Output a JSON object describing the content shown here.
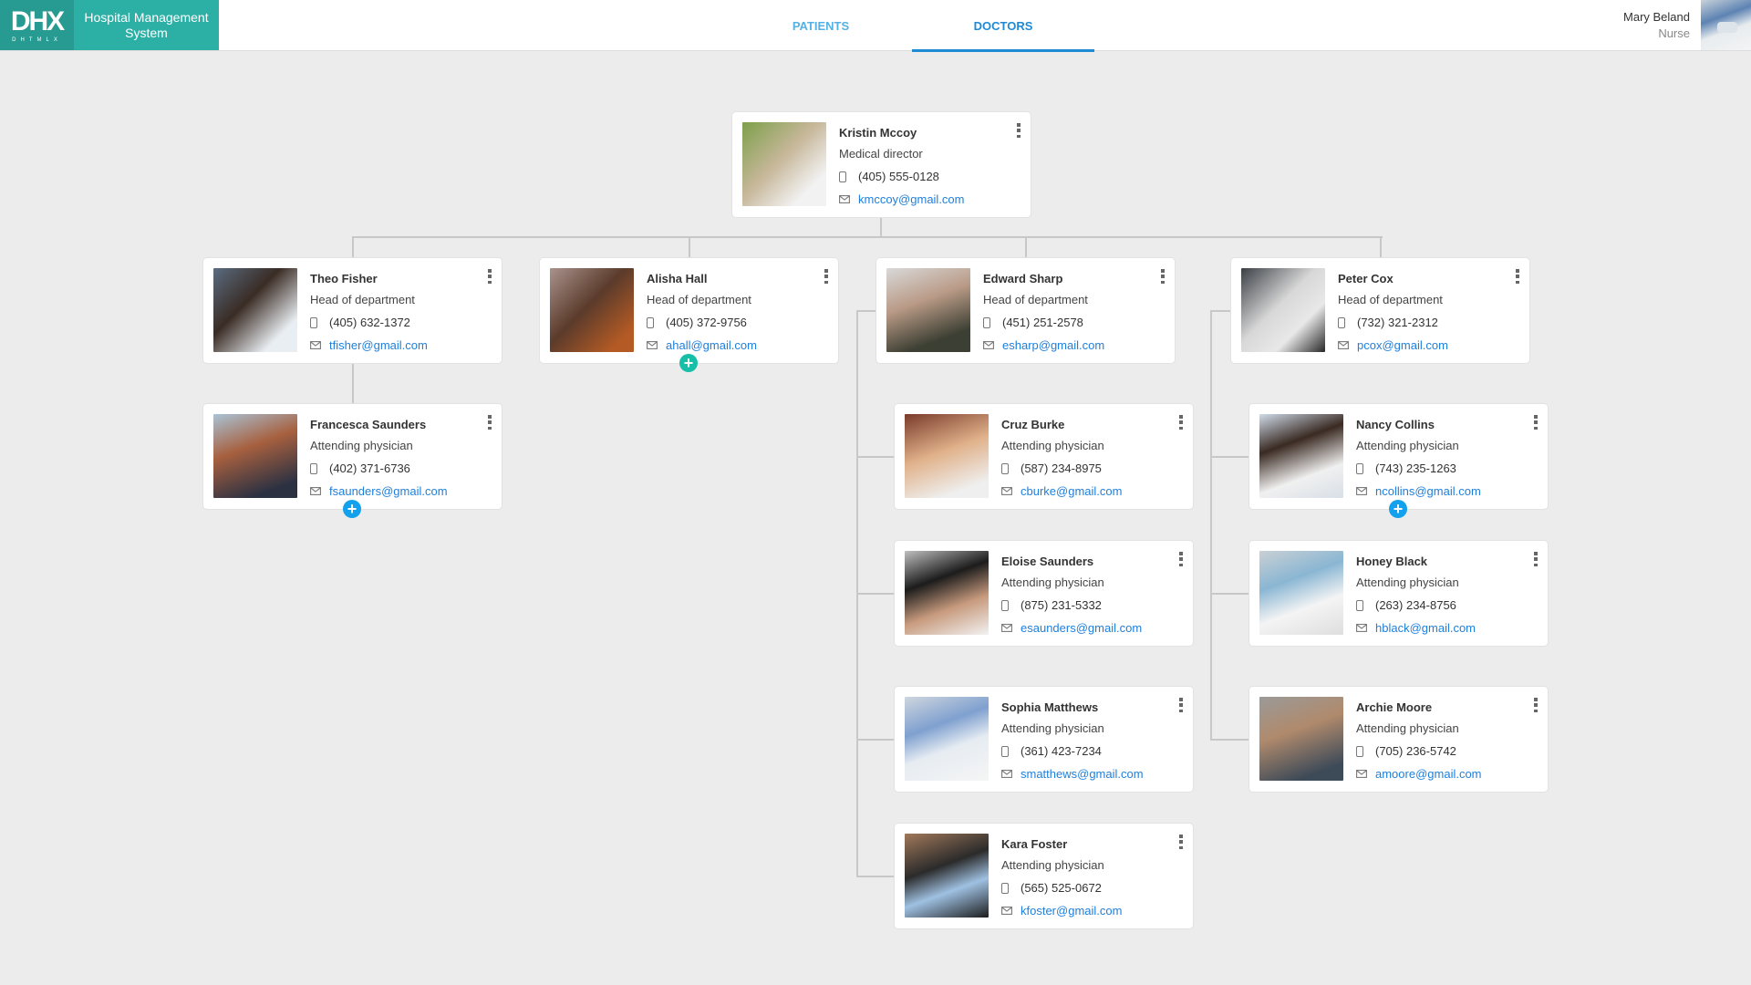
{
  "app": {
    "logo_text": "DHX",
    "logo_subtext": "DHTMLX",
    "title": "Hospital Management System"
  },
  "tabs": [
    {
      "label": "PATIENTS",
      "active": false
    },
    {
      "label": "DOCTORS",
      "active": true
    }
  ],
  "user": {
    "name": "Mary Beland",
    "role": "Nurse"
  },
  "colors": {
    "brand": "#2cb0a6",
    "accent": "#1f8ad4",
    "link": "#1f7fdb",
    "add_blue": "#13a0ec",
    "add_teal": "#17bfa8"
  },
  "doctors": [
    {
      "id": "kmccoy",
      "name": "Kristin Mccoy",
      "title": "Medical director",
      "phone": "(405) 555-0128",
      "email": "kmccoy@gmail.com",
      "parent": null
    },
    {
      "id": "tfisher",
      "name": "Theo Fisher",
      "title": "Head of department",
      "phone": "(405) 632-1372",
      "email": "tfisher@gmail.com",
      "parent": "kmccoy"
    },
    {
      "id": "ahall",
      "name": "Alisha Hall",
      "title": "Head of department",
      "phone": "(405) 372-9756",
      "email": "ahall@gmail.com",
      "parent": "kmccoy"
    },
    {
      "id": "esharp",
      "name": "Edward Sharp",
      "title": "Head of department",
      "phone": "(451) 251-2578",
      "email": "esharp@gmail.com",
      "parent": "kmccoy"
    },
    {
      "id": "pcox",
      "name": "Peter Cox",
      "title": "Head of department",
      "phone": "(732) 321-2312",
      "email": "pcox@gmail.com",
      "parent": "kmccoy"
    },
    {
      "id": "fsaunders",
      "name": "Francesca Saunders",
      "title": "Attending physician",
      "phone": "(402) 371-6736",
      "email": "fsaunders@gmail.com",
      "parent": "tfisher"
    },
    {
      "id": "cburke",
      "name": "Cruz Burke",
      "title": "Attending physician",
      "phone": "(587) 234-8975",
      "email": "cburke@gmail.com",
      "parent": "esharp"
    },
    {
      "id": "esaunders",
      "name": "Eloise Saunders",
      "title": "Attending physician",
      "phone": "(875) 231-5332",
      "email": "esaunders@gmail.com",
      "parent": "esharp"
    },
    {
      "id": "smatthews",
      "name": "Sophia Matthews",
      "title": "Attending physician",
      "phone": "(361) 423-7234",
      "email": "smatthews@gmail.com",
      "parent": "esharp"
    },
    {
      "id": "kfoster",
      "name": "Kara Foster",
      "title": "Attending physician",
      "phone": "(565) 525-0672",
      "email": "kfoster@gmail.com",
      "parent": "esharp"
    },
    {
      "id": "ncollins",
      "name": "Nancy Collins",
      "title": "Attending physician",
      "phone": "(743) 235-1263",
      "email": "ncollins@gmail.com",
      "parent": "pcox"
    },
    {
      "id": "hblack",
      "name": "Honey Black",
      "title": "Attending physician",
      "phone": "(263) 234-8756",
      "email": "hblack@gmail.com",
      "parent": "pcox"
    },
    {
      "id": "amoore",
      "name": "Archie Moore",
      "title": "Attending physician",
      "phone": "(705) 236-5742",
      "email": "amoore@gmail.com",
      "parent": "pcox"
    }
  ],
  "add_buttons": [
    {
      "label": "+",
      "under": "fsaunders",
      "color": "blue"
    },
    {
      "label": "+",
      "under": "ahall",
      "color": "teal"
    },
    {
      "label": "+",
      "under": "ncollins",
      "color": "blue"
    }
  ]
}
